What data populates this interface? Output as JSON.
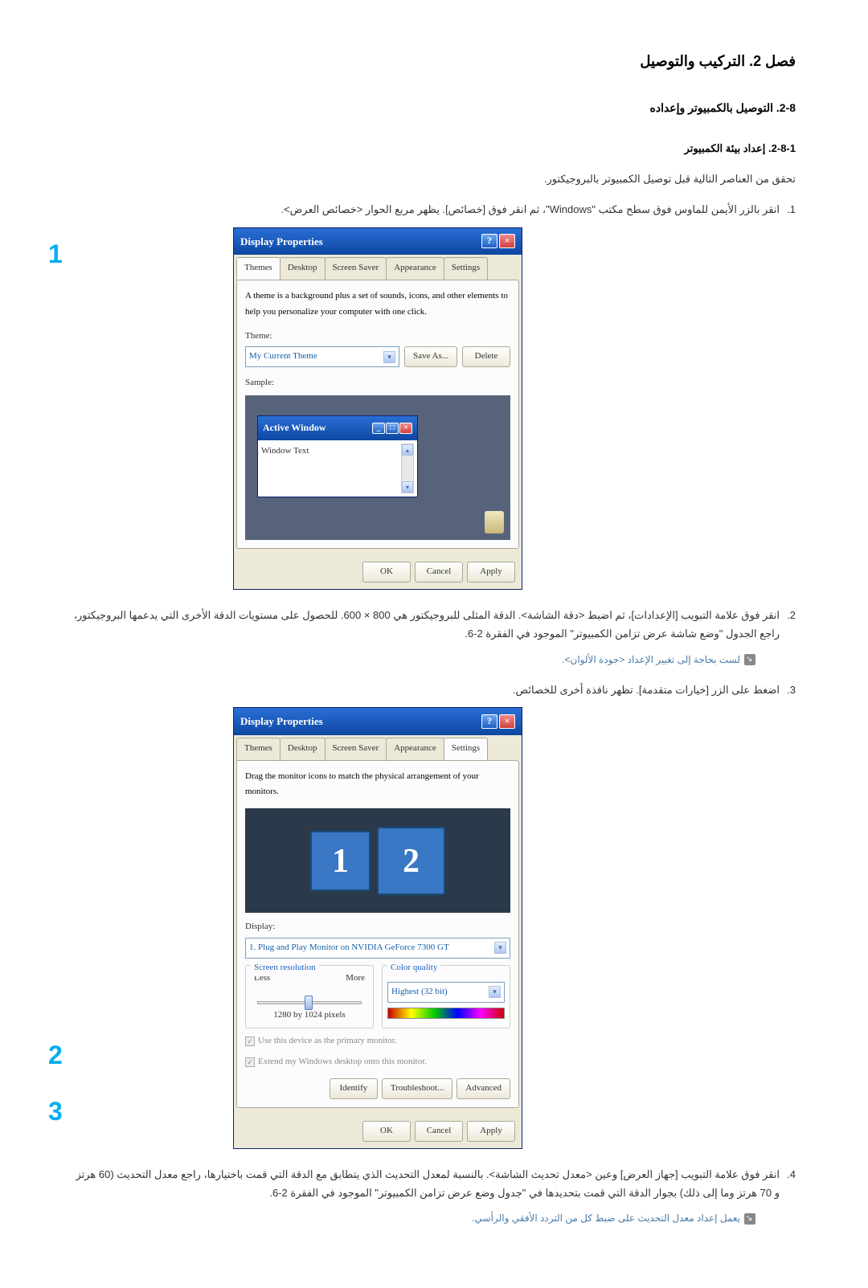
{
  "headings": {
    "chapter": "فصل 2. التركيب والتوصيل",
    "section": "2-8. التوصيل بالكمبيوتر وإعداده",
    "subsection": "2-8-1. إعداد بيئة الكمبيوتر"
  },
  "intro": "تحقق من العناصر التالية قبل توصيل الكمبيوتر بالبروجيكتور.",
  "steps": {
    "s1": "انقر بالزر الأيمن للماوس فوق سطح مكتب \"Windows\"، ثم انقر فوق [خصائص]. يظهر مربع الحوار <خصائص العرض>.",
    "s2": "انقر فوق علامة التبويب [الإعدادات]، ثم اضبط <دقة الشاشة>. الدقة المثلى للبروجيكتور هي 800 × 600. للحصول على مستويات الدقة الأخرى التي يدعمها البروجيكتور، راجع الجدول \"وضع شاشة عرض تزامن الكمبيوتر\" الموجود في الفقرة 2-6.",
    "s3": "اضغط على الزر [خيارات متقدمة]. تظهر نافذة أخرى للخصائص.",
    "s4": "انقر فوق علامة التبويب [جهاز العرض] وعين <معدل تحديث الشاشة>. بالنسبة لمعدل التحديث الذي يتطابق مع الدقة التي قمت باختيارها، راجع معدل التحديث (60 هرتز و 70 هرتز وما إلى ذلك) بجوار الدقة التي قمت بتحديدها في \"جدول وضع عرض تزامن الكمبيوتر\" الموجود في الفقرة 2-6."
  },
  "notes": {
    "n1": "لست بحاجة إلى تغيير الإعداد <جودة الألوان>.",
    "n2": "يعمل إعداد معدل التحديث على ضبط كل من التردد الأفقي والرأسي."
  },
  "dialog1": {
    "title": "Display Properties",
    "tabs": {
      "themes": "Themes",
      "desktop": "Desktop",
      "saver": "Screen Saver",
      "appearance": "Appearance",
      "settings": "Settings"
    },
    "desc": "A theme is a background plus a set of sounds, icons, and other elements to help you personalize your computer with one click.",
    "theme_label": "Theme:",
    "theme_value": "My Current Theme",
    "save_as": "Save As...",
    "delete": "Delete",
    "sample_label": "Sample:",
    "active_window": "Active Window",
    "window_text": "Window Text",
    "ok": "OK",
    "cancel": "Cancel",
    "apply": "Apply"
  },
  "dialog2": {
    "title": "Display Properties",
    "tabs": {
      "themes": "Themes",
      "desktop": "Desktop",
      "saver": "Screen Saver",
      "appearance": "Appearance",
      "settings": "Settings"
    },
    "desc": "Drag the monitor icons to match the physical arrangement of your monitors.",
    "display_label": "Display:",
    "display_value": "1. Plug and Play Monitor on NVIDIA GeForce 7300 GT",
    "res_title": "Screen resolution",
    "less": "Less",
    "more": "More",
    "res_value": "1280 by 1024 pixels",
    "quality_title": "Color quality",
    "quality_value": "Highest (32 bit)",
    "chk1": "Use this device as the primary monitor.",
    "chk2": "Extend my Windows desktop onto this monitor.",
    "identify": "Identify",
    "troubleshoot": "Troubleshoot...",
    "advanced": "Advanced",
    "ok": "OK",
    "cancel": "Cancel",
    "apply": "Apply",
    "mon1": "1",
    "mon2": "2"
  },
  "callouts": {
    "c1": "1",
    "c2": "2",
    "c3": "3"
  }
}
